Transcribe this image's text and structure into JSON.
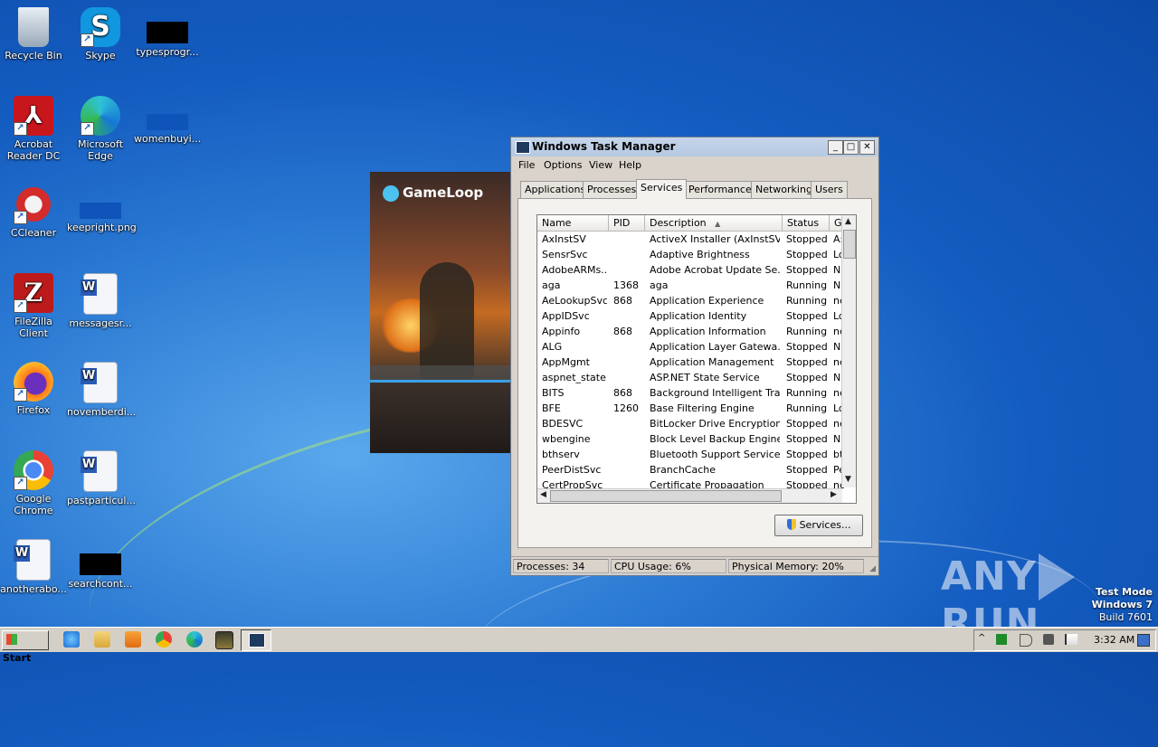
{
  "desktop": {
    "icons": [
      {
        "label": "Recycle Bin",
        "icon": "recycle-bin-icon"
      },
      {
        "label": "Skype",
        "icon": "skype-icon"
      },
      {
        "label": "typesprogr...",
        "icon": "file-icon"
      },
      {
        "label": "Acrobat Reader DC",
        "icon": "acrobat-icon"
      },
      {
        "label": "Microsoft Edge",
        "icon": "edge-icon"
      },
      {
        "label": "womenbuyi...",
        "icon": "file-icon"
      },
      {
        "label": "CCleaner",
        "icon": "ccleaner-icon"
      },
      {
        "label": "keepright.png",
        "icon": "image-file-icon"
      },
      {
        "label": "FileZilla Client",
        "icon": "filezilla-icon"
      },
      {
        "label": "messagesr...",
        "icon": "word-doc-icon"
      },
      {
        "label": "Firefox",
        "icon": "firefox-icon"
      },
      {
        "label": "novemberdi...",
        "icon": "word-doc-icon"
      },
      {
        "label": "Google Chrome",
        "icon": "chrome-icon"
      },
      {
        "label": "pastparticul...",
        "icon": "word-doc-icon"
      },
      {
        "label": "anotherabo...",
        "icon": "word-doc-icon"
      },
      {
        "label": "searchcont...",
        "icon": "file-icon"
      }
    ]
  },
  "gameloop": {
    "logo_text": "GameLoop"
  },
  "taskmanager": {
    "title": "Windows Task Manager",
    "window_buttons": {
      "minimize": "_",
      "maximize": "□",
      "close": "✕"
    },
    "menu": [
      "File",
      "Options",
      "View",
      "Help"
    ],
    "tabs": [
      "Applications",
      "Processes",
      "Services",
      "Performance",
      "Networking",
      "Users"
    ],
    "active_tab": "Services",
    "columns": [
      "Name",
      "PID",
      "Description",
      "Status",
      "Gr"
    ],
    "sort_indicator": "▲",
    "rows": [
      [
        "AxInstSV",
        "",
        "ActiveX Installer (AxInstSV)",
        "Stopped",
        "A:"
      ],
      [
        "SensrSvc",
        "",
        "Adaptive Brightness",
        "Stopped",
        "Lo"
      ],
      [
        "AdobeARMs...",
        "",
        "Adobe Acrobat Update Se...",
        "Stopped",
        "N,"
      ],
      [
        "aga",
        "1368",
        "aga",
        "Running",
        "N,"
      ],
      [
        "AeLookupSvc",
        "868",
        "Application Experience",
        "Running",
        "ne"
      ],
      [
        "AppIDSvc",
        "",
        "Application Identity",
        "Stopped",
        "Lo"
      ],
      [
        "Appinfo",
        "868",
        "Application Information",
        "Running",
        "ne"
      ],
      [
        "ALG",
        "",
        "Application Layer Gatewa...",
        "Stopped",
        "N,"
      ],
      [
        "AppMgmt",
        "",
        "Application Management",
        "Stopped",
        "ne"
      ],
      [
        "aspnet_state",
        "",
        "ASP.NET State Service",
        "Stopped",
        "N,"
      ],
      [
        "BITS",
        "868",
        "Background Intelligent Tra...",
        "Running",
        "ne"
      ],
      [
        "BFE",
        "1260",
        "Base Filtering Engine",
        "Running",
        "Lo"
      ],
      [
        "BDESVC",
        "",
        "BitLocker Drive Encryption...",
        "Stopped",
        "ne"
      ],
      [
        "wbengine",
        "",
        "Block Level Backup Engine ...",
        "Stopped",
        "N,"
      ],
      [
        "bthserv",
        "",
        "Bluetooth Support Service",
        "Stopped",
        "bt"
      ],
      [
        "PeerDistSvc",
        "",
        "BranchCache",
        "Stopped",
        "Pe"
      ],
      [
        "CertPropSvc",
        "",
        "Certificate Propagation",
        "Stopped",
        "ne"
      ]
    ],
    "services_button": "Services...",
    "status": {
      "processes": "Processes: 34",
      "cpu": "CPU Usage: 6%",
      "memory": "Physical Memory: 20%"
    }
  },
  "watermark": {
    "left": "ANY",
    "right": "RUN"
  },
  "testmode": {
    "line1": "Test Mode",
    "line2": "Windows 7",
    "line3": "Build 7601"
  },
  "taskbar": {
    "start_label": "Start",
    "clock": "3:32 AM"
  }
}
